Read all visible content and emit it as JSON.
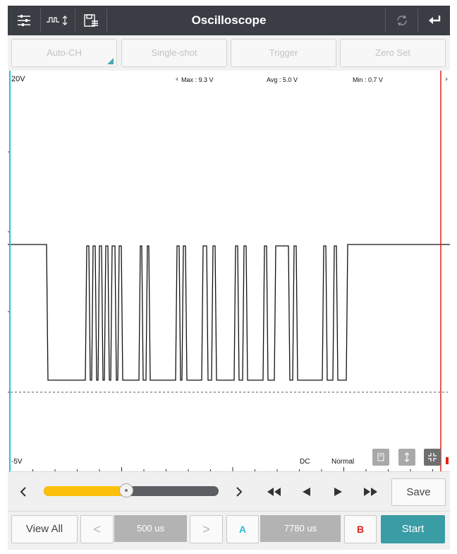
{
  "app": {
    "title": "Oscilloscope"
  },
  "tabs": [
    {
      "label": "Auto-CH"
    },
    {
      "label": "Single-shot"
    },
    {
      "label": "Trigger"
    },
    {
      "label": "Zero Set"
    }
  ],
  "plot": {
    "volt_top": "20V",
    "volt_bottom": "-5V",
    "max_label": "Max : 9.3 V",
    "avg_label": "Avg : 5.0 V",
    "min_label": "Min : 0.7 V",
    "coupling": "DC",
    "mode": "Normal"
  },
  "controls": {
    "slider_level": 0.47,
    "save_label": "Save"
  },
  "footer": {
    "view_all_label": "View All",
    "prev_symbol": "<",
    "next_symbol": ">",
    "timebase": "500 us",
    "cursor_a_label": "A",
    "cursor_value": "7780 us",
    "cursor_b_label": "B",
    "start_label": "Start"
  },
  "colors": {
    "titlebar": "#3a3d44",
    "accent_teal": "#3a9ca5",
    "cursor_a": "#29c0d6",
    "cursor_b": "#e0241b",
    "slider_fill": "#fcc00a",
    "slider_track": "#5b5e63"
  }
}
